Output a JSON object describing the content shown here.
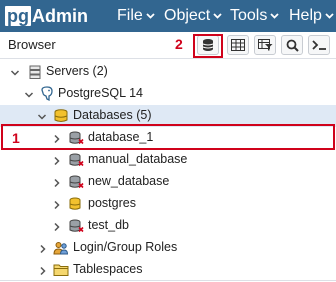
{
  "app": {
    "logo_prefix": "pg",
    "logo_suffix": "Admin"
  },
  "menu": [
    {
      "label": "File"
    },
    {
      "label": "Object"
    },
    {
      "label": "Tools"
    },
    {
      "label": "Help"
    }
  ],
  "browser": {
    "title": "Browser",
    "annotation_marker": "2",
    "toolbar_icons": [
      "query-tool-icon",
      "view-data-icon",
      "filtered-rows-icon",
      "search-icon",
      "psql-terminal-icon"
    ]
  },
  "tree": {
    "annotation_marker": "1",
    "nodes": [
      {
        "label": "Servers (2)",
        "icon": "servers-icon",
        "expanded": true
      },
      {
        "label": "PostgreSQL 14",
        "icon": "elephant-icon",
        "expanded": true
      },
      {
        "label": "Databases (5)",
        "icon": "databases-icon",
        "expanded": true,
        "selected": true
      },
      {
        "label": "database_1",
        "icon": "database-disconnected-icon",
        "expanded": false
      },
      {
        "label": "manual_database",
        "icon": "database-disconnected-icon",
        "expanded": false
      },
      {
        "label": "new_database",
        "icon": "database-disconnected-icon",
        "expanded": false
      },
      {
        "label": "postgres",
        "icon": "database-icon",
        "expanded": false
      },
      {
        "label": "test_db",
        "icon": "database-disconnected-icon",
        "expanded": false
      },
      {
        "label": "Login/Group Roles",
        "icon": "roles-icon",
        "expanded": false
      },
      {
        "label": "Tablespaces",
        "icon": "tablespaces-icon",
        "expanded": false
      }
    ]
  },
  "colors": {
    "navbar": "#326690",
    "selection": "#dfe9f5",
    "highlight": "#d0021b",
    "db_yellow": "#f2c12e"
  }
}
